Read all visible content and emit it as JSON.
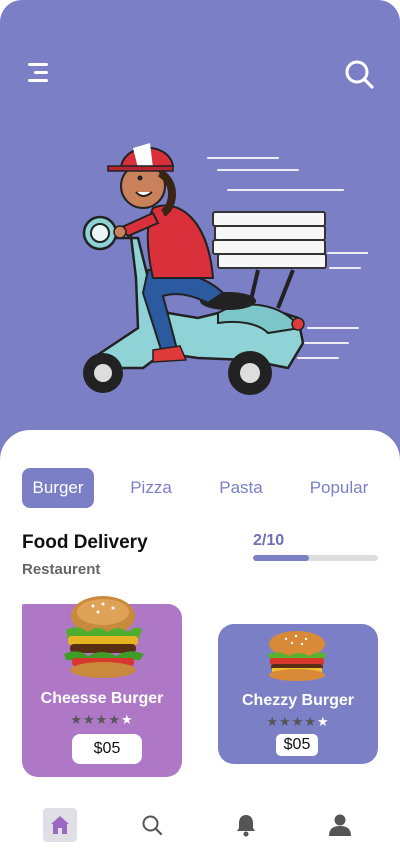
{
  "header": {
    "menu_icon": "menu-icon",
    "search_icon": "search-icon",
    "background_color": "#7b7fc6"
  },
  "tabs": [
    {
      "label": "Burger",
      "active": true
    },
    {
      "label": "Pizza",
      "active": false
    },
    {
      "label": "Pasta",
      "active": false
    },
    {
      "label": "Popular",
      "active": false
    }
  ],
  "section": {
    "title": "Food Delivery",
    "subtitle": "Restaurent",
    "progress_label": "2/10",
    "progress_fraction": 0.45
  },
  "cards": [
    {
      "name": "Cheesse Burger",
      "price": "$05",
      "rating": 4,
      "rating_max": 5,
      "color": "#ae78c6"
    },
    {
      "name": "Chezzy Burger",
      "price": "$05",
      "rating": 4,
      "rating_max": 5,
      "color": "#7b7fc6"
    }
  ],
  "bottom_nav": [
    {
      "icon": "home-icon",
      "active": true
    },
    {
      "icon": "search-icon",
      "active": false
    },
    {
      "icon": "bell-icon",
      "active": false
    },
    {
      "icon": "user-icon",
      "active": false
    }
  ],
  "colors": {
    "accent": "#7b7fc6",
    "card_purple": "#ae78c6",
    "home_active": "#9b6ac0"
  }
}
